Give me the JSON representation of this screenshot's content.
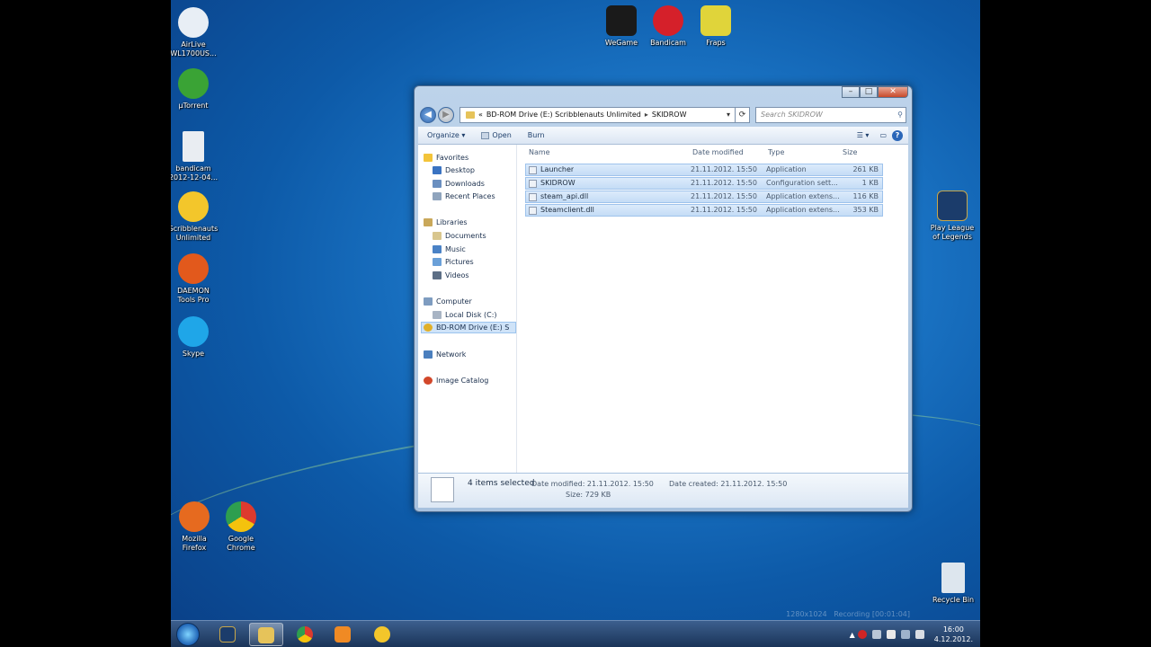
{
  "desktop_icons": [
    {
      "label": "AirLive WL1700US...",
      "icon": "wifi-antenna-icon",
      "color": "#e8eef5"
    },
    {
      "label": "µTorrent",
      "icon": "utorrent-icon",
      "color": "#3aa335"
    },
    {
      "label": "bandicam 2012-12-04...",
      "icon": "avi-file-icon",
      "color": "#e9edf2"
    },
    {
      "label": "Scribblenauts Unlimited",
      "icon": "scribblenauts-star-icon",
      "color": "#f3c62b"
    },
    {
      "label": "DAEMON Tools Pro",
      "icon": "daemon-tools-icon",
      "color": "#e2591c"
    },
    {
      "label": "Skype",
      "icon": "skype-icon",
      "color": "#1fa6e8"
    },
    {
      "label": "WeGame",
      "icon": "wegame-icon",
      "color": "#1a1a1a"
    },
    {
      "label": "Bandicam",
      "icon": "bandicam-icon",
      "color": "#d5202a"
    },
    {
      "label": "Fraps",
      "icon": "fraps-icon",
      "color": "#e0d43a"
    },
    {
      "label": "Play League of Legends",
      "icon": "league-of-legends-icon",
      "color": "#1b3c6b"
    },
    {
      "label": "Mozilla Firefox",
      "icon": "firefox-icon",
      "color": "#e66a1f"
    },
    {
      "label": "Google Chrome",
      "icon": "chrome-icon",
      "color": "#dd3a2e"
    },
    {
      "label": "Recycle Bin",
      "icon": "recycle-bin-icon",
      "color": "#dde6ee"
    }
  ],
  "window": {
    "address": {
      "overflow": "«",
      "segments": [
        "BD-ROM Drive (E:) Scribblenauts Unlimited",
        "SKIDROW"
      ]
    },
    "search_placeholder": "Search SKIDROW",
    "toolbar": {
      "organize": "Organize ▾",
      "open": "Open",
      "burn": "Burn"
    },
    "nav": {
      "favorites": "Favorites",
      "desktop": "Desktop",
      "downloads": "Downloads",
      "recent": "Recent Places",
      "libraries": "Libraries",
      "documents": "Documents",
      "music": "Music",
      "pictures": "Pictures",
      "videos": "Videos",
      "computer": "Computer",
      "local_disk": "Local Disk (C:)",
      "bd_rom": "BD-ROM Drive (E:) S",
      "network": "Network",
      "image_catalog": "Image Catalog"
    },
    "columns": {
      "name": "Name",
      "date": "Date modified",
      "type": "Type",
      "size": "Size"
    },
    "files": [
      {
        "name": "Launcher",
        "date": "21.11.2012. 15:50",
        "type": "Application",
        "size": "261 KB"
      },
      {
        "name": "SKIDROW",
        "date": "21.11.2012. 15:50",
        "type": "Configuration sett...",
        "size": "1 KB"
      },
      {
        "name": "steam_api.dll",
        "date": "21.11.2012. 15:50",
        "type": "Application extens...",
        "size": "116 KB"
      },
      {
        "name": "Steamclient.dll",
        "date": "21.11.2012. 15:50",
        "type": "Application extens...",
        "size": "353 KB"
      }
    ],
    "details": {
      "selected": "4 items selected",
      "date_modified": "Date modified: 21.11.2012. 15:50",
      "size": "Size: 729 KB",
      "date_created": "Date created: 21.11.2012. 15:50"
    }
  },
  "taskbar": {
    "clock_time": "16:00",
    "clock_date": "4.12.2012.",
    "recording": "Recording [00:01:04]",
    "resolution": "1280x1024"
  }
}
